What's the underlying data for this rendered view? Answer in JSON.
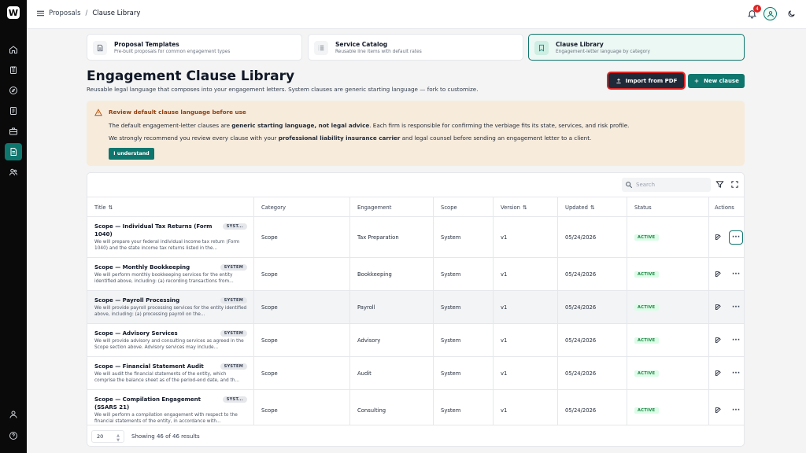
{
  "topbar": {
    "breadcrumbs": [
      "Proposals",
      "/",
      "Clause Library"
    ],
    "notification_count": "4"
  },
  "nav_cards": [
    {
      "title": "Proposal Templates",
      "subtitle": "Pre-built proposals for common engagement types",
      "icon": "document-icon"
    },
    {
      "title": "Service Catalog",
      "subtitle": "Reusable line items with default rates",
      "icon": "list-icon"
    },
    {
      "title": "Clause Library",
      "subtitle": "Engagement-letter language by category",
      "icon": "bookmark-icon"
    }
  ],
  "page": {
    "title": "Engagement Clause Library",
    "subtitle": "Reusable legal language that composes into your engagement letters. System clauses are generic starting language — fork to customize.",
    "import_label": "Import from PDF",
    "new_label": "New clause"
  },
  "warning": {
    "title": "Review default clause language before use",
    "line1_a": "The default engagement-letter clauses are ",
    "line1_b": "generic starting language, not legal advice",
    "line1_c": ". Each firm is responsible for confirming the verbiage fits its state, services, and risk profile.",
    "line2_a": "We strongly recommend you review every clause with your ",
    "line2_b": "professional liability insurance carrier",
    "line2_c": " and legal counsel before sending an engagement letter to a client.",
    "button": "I understand"
  },
  "table": {
    "search_placeholder": "Search",
    "headers": [
      "Title",
      "Category",
      "Engagement",
      "Scope",
      "Version",
      "Updated",
      "Status",
      "Actions"
    ],
    "sort_mark": "⇅",
    "rows": [
      {
        "title": "Scope — Individual Tax Returns (Form 1040)",
        "badge": "SYST...",
        "desc": "We will prepare your federal individual income tax return (Form 1040) and the state income tax returns listed in the...",
        "category": "Scope",
        "engagement": "Tax Preparation",
        "scope": "System",
        "version": "v1",
        "updated": "05/24/2026",
        "status": "ACTIVE"
      },
      {
        "title": "Scope — Monthly Bookkeeping",
        "badge": "SYSTEM",
        "desc": "We will perform monthly bookkeeping services for the entity identified above, including: (a) recording transactions from...",
        "category": "Scope",
        "engagement": "Bookkeeping",
        "scope": "System",
        "version": "v1",
        "updated": "05/24/2026",
        "status": "ACTIVE"
      },
      {
        "title": "Scope — Payroll Processing",
        "badge": "SYSTEM",
        "desc": "We will provide payroll processing services for the entity identified above, including: (a) processing payroll on the...",
        "category": "Scope",
        "engagement": "Payroll",
        "scope": "System",
        "version": "v1",
        "updated": "05/24/2026",
        "status": "ACTIVE"
      },
      {
        "title": "Scope — Advisory Services",
        "badge": "SYSTEM",
        "desc": "We will provide advisory and consulting services as agreed in the Scope section above. Advisory services may include...",
        "category": "Scope",
        "engagement": "Advisory",
        "scope": "System",
        "version": "v1",
        "updated": "05/24/2026",
        "status": "ACTIVE"
      },
      {
        "title": "Scope — Financial Statement Audit",
        "badge": "SYSTEM",
        "desc": "We will audit the financial statements of the entity, which comprise the balance sheet as of the period-end date, and th...",
        "category": "Scope",
        "engagement": "Audit",
        "scope": "System",
        "version": "v1",
        "updated": "05/24/2026",
        "status": "ACTIVE"
      },
      {
        "title": "Scope — Compilation Engagement (SSARS 21)",
        "badge": "SYST...",
        "desc": "We will perform a compilation engagement with respect to the financial statements of the entity, in accordance with...",
        "category": "Scope",
        "engagement": "Consulting",
        "scope": "System",
        "version": "v1",
        "updated": "05/24/2026",
        "status": "ACTIVE"
      }
    ]
  },
  "footer": {
    "page_size": "20",
    "showing": "Showing 46 of 46 results"
  }
}
